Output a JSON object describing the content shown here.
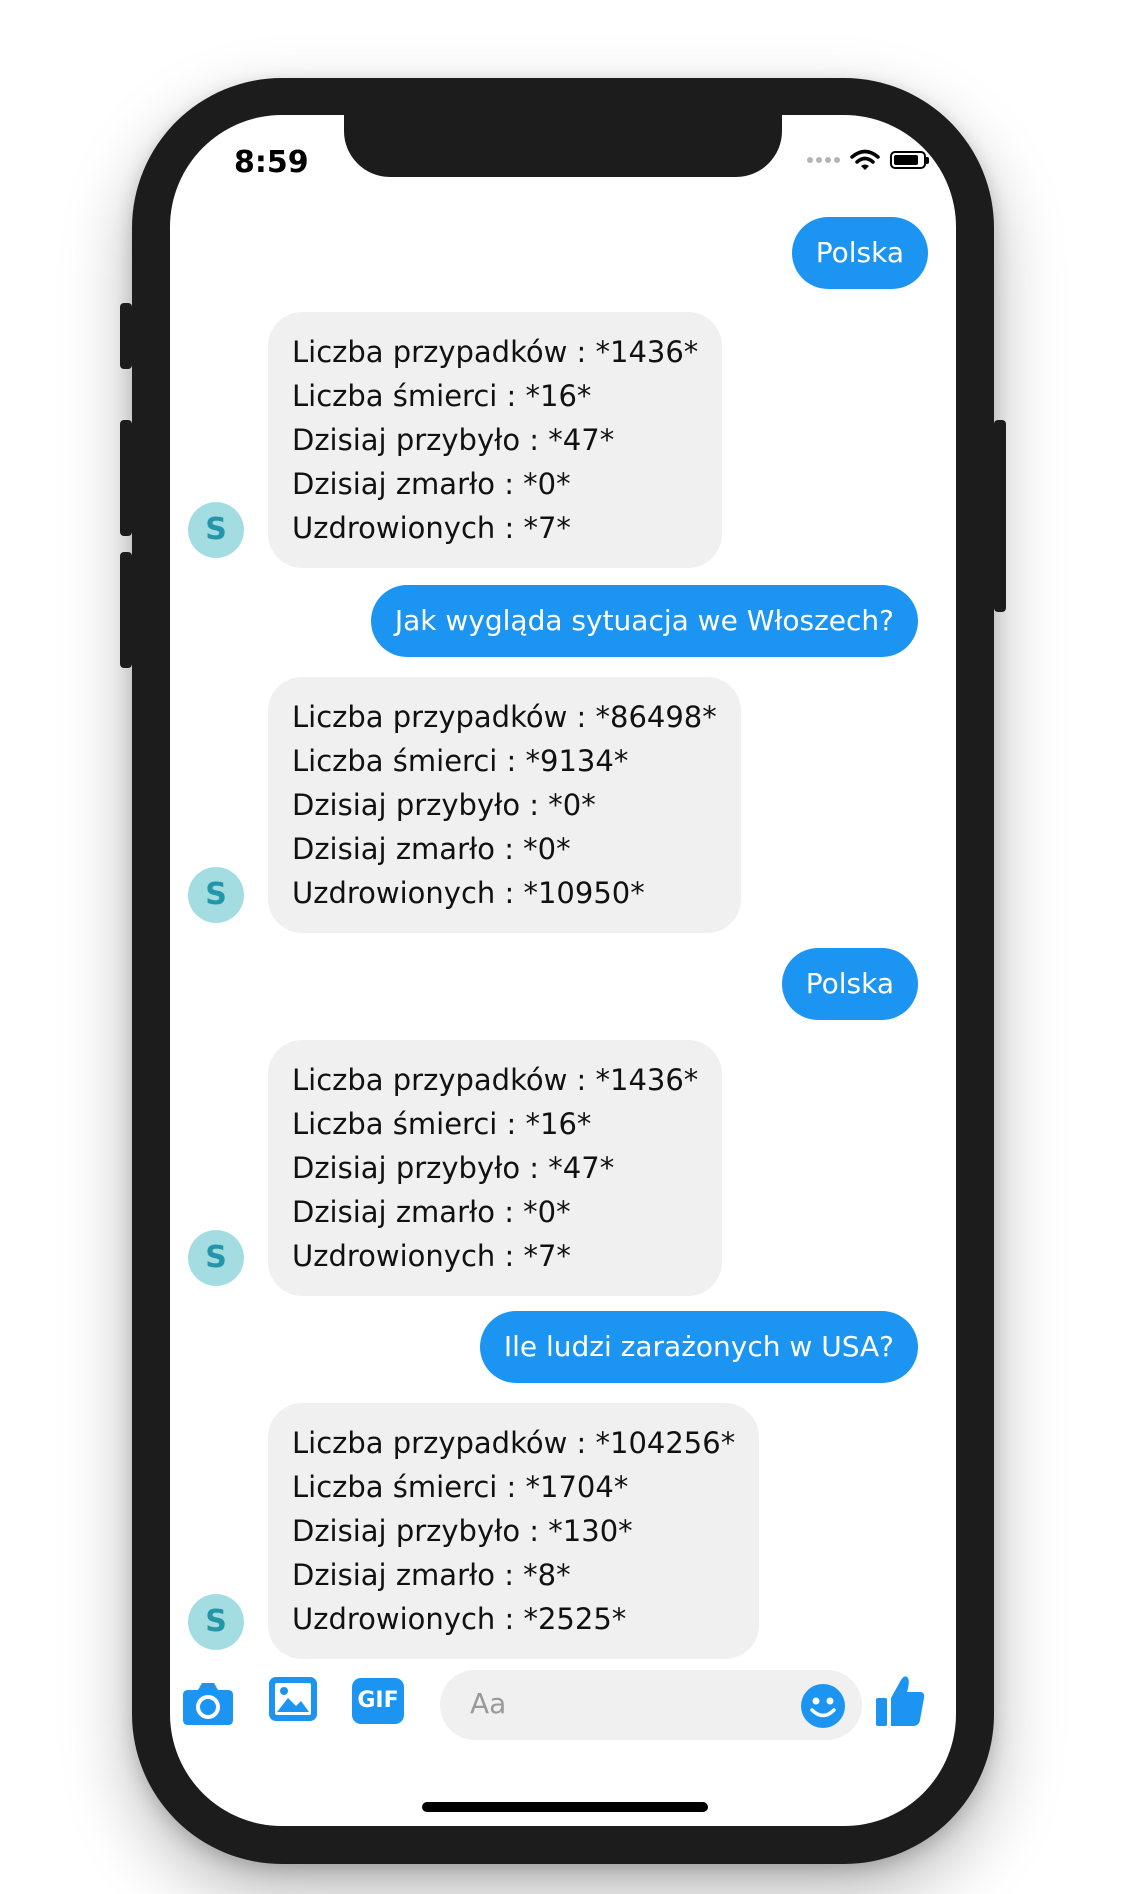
{
  "status_bar": {
    "time": "8:59"
  },
  "messages": [
    {
      "type": "out",
      "text": "Polska"
    },
    {
      "type": "in",
      "lines": [
        "Liczba przypadków : *1436*",
        "Liczba śmierci : *16*",
        "Dzisiaj przybyło : *47*",
        "Dzisiaj zmarło : *0*",
        "Uzdrowionych : *7*"
      ]
    },
    {
      "type": "out",
      "text": "Jak wygląda sytuacja we Włoszech?"
    },
    {
      "type": "in",
      "lines": [
        "Liczba przypadków : *86498*",
        "Liczba śmierci : *9134*",
        "Dzisiaj przybyło : *0*",
        "Dzisiaj zmarło : *0*",
        "Uzdrowionych : *10950*"
      ]
    },
    {
      "type": "out",
      "text": "Polska"
    },
    {
      "type": "in",
      "lines": [
        "Liczba przypadków : *1436*",
        "Liczba śmierci : *16*",
        "Dzisiaj przybyło : *47*",
        "Dzisiaj zmarło : *0*",
        "Uzdrowionych : *7*"
      ]
    },
    {
      "type": "out",
      "text": "Ile ludzi zarażonych w USA?"
    },
    {
      "type": "in",
      "lines": [
        "Liczba przypadków : *104256*",
        "Liczba śmierci : *1704*",
        "Dzisiaj przybyło : *130*",
        "Dzisiaj zmarło : *8*",
        "Uzdrowionych : *2525*"
      ]
    }
  ],
  "avatar_letter": "S",
  "composer": {
    "placeholder": "Aa",
    "gif_label": "GIF",
    "icons": [
      "camera-icon",
      "image-icon",
      "gif-icon",
      "emoji-icon",
      "thumbs-up-icon"
    ]
  },
  "colors": {
    "accent": "#1c95f2",
    "incoming_bubble": "#f0f0f0",
    "avatar_bg": "#a3dde2",
    "avatar_text": "#2596a8"
  }
}
